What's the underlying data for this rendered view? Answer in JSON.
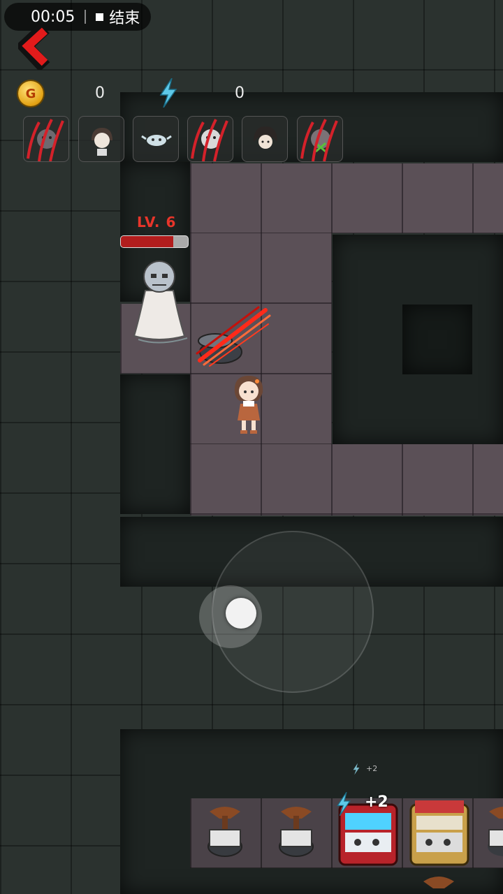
{
  "status_bar": {
    "time": "00:05",
    "end_label": "结束"
  },
  "hud": {
    "coin_symbol": "G",
    "coins": "0",
    "energy": "0",
    "colors": {
      "coin": "#e3a113",
      "energy": "#5ec8e8",
      "claw": "#d4212a"
    }
  },
  "party": [
    {
      "name": "ghost-portrait-1",
      "icon": "ghost-face",
      "clawed": true
    },
    {
      "name": "girl-portrait",
      "icon": "girl-face",
      "clawed": false
    },
    {
      "name": "spirit-portrait",
      "icon": "wisp-face",
      "clawed": false
    },
    {
      "name": "ghost-portrait-2",
      "icon": "ghost-face",
      "clawed": true
    },
    {
      "name": "boy-portrait",
      "icon": "boy-face",
      "clawed": false
    },
    {
      "name": "ghost-portrait-3",
      "icon": "green-ghost-face",
      "clawed": true
    }
  ],
  "enemy": {
    "level_text": "LV. 6",
    "hp_fraction": 0.78
  },
  "gains": {
    "small": "+2",
    "big": "+2"
  }
}
